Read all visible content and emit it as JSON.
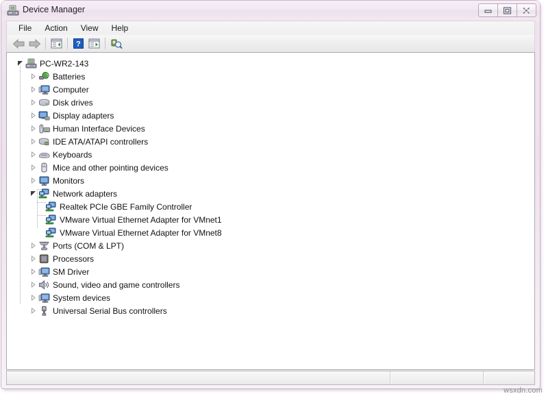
{
  "window": {
    "title": "Device Manager",
    "title_icon": "device-manager-icon",
    "caption_buttons": [
      {
        "name": "minimize-button",
        "glyph": "minimize"
      },
      {
        "name": "maximize-button",
        "glyph": "maximize"
      },
      {
        "name": "close-button",
        "glyph": "close"
      }
    ]
  },
  "menubar": {
    "items": [
      {
        "label": "File",
        "name": "menu-file"
      },
      {
        "label": "Action",
        "name": "menu-action"
      },
      {
        "label": "View",
        "name": "menu-view"
      },
      {
        "label": "Help",
        "name": "menu-help"
      }
    ]
  },
  "toolbar": {
    "buttons": [
      {
        "name": "back-button",
        "icon": "back-arrow-icon",
        "enabled": false
      },
      {
        "name": "forward-button",
        "icon": "forward-arrow-icon",
        "enabled": false
      },
      {
        "name": "show-hide-console-tree-button",
        "icon": "console-tree-icon",
        "enabled": true
      },
      {
        "name": "help-button",
        "icon": "help-question-icon",
        "enabled": true
      },
      {
        "name": "properties-button",
        "icon": "properties-window-icon",
        "enabled": true
      },
      {
        "name": "scan-for-hardware-changes-button",
        "icon": "scan-hardware-icon",
        "enabled": true
      }
    ]
  },
  "tree": {
    "root": {
      "label": "PC-WR2-143",
      "icon": "computer-node-icon",
      "expanded": true
    },
    "items": [
      {
        "label": "Batteries",
        "icon": "battery-icon",
        "expanded": false,
        "level": 1
      },
      {
        "label": "Computer",
        "icon": "computer-icon",
        "expanded": false,
        "level": 1
      },
      {
        "label": "Disk drives",
        "icon": "disk-drive-icon",
        "expanded": false,
        "level": 1
      },
      {
        "label": "Display adapters",
        "icon": "display-adapter-icon",
        "expanded": false,
        "level": 1
      },
      {
        "label": "Human Interface Devices",
        "icon": "hid-icon",
        "expanded": false,
        "level": 1
      },
      {
        "label": "IDE ATA/ATAPI controllers",
        "icon": "ide-controller-icon",
        "expanded": false,
        "level": 1
      },
      {
        "label": "Keyboards",
        "icon": "keyboard-icon",
        "expanded": false,
        "level": 1
      },
      {
        "label": "Mice and other pointing devices",
        "icon": "mouse-icon",
        "expanded": false,
        "level": 1
      },
      {
        "label": "Monitors",
        "icon": "monitor-icon",
        "expanded": false,
        "level": 1
      },
      {
        "label": "Network adapters",
        "icon": "network-adapter-icon",
        "expanded": true,
        "level": 1
      },
      {
        "label": "Realtek PCIe GBE Family Controller",
        "icon": "network-adapter-icon",
        "expanded": null,
        "level": 2
      },
      {
        "label": "VMware Virtual Ethernet Adapter for VMnet1",
        "icon": "network-adapter-icon",
        "expanded": null,
        "level": 2
      },
      {
        "label": "VMware Virtual Ethernet Adapter for VMnet8",
        "icon": "network-adapter-icon",
        "expanded": null,
        "level": 2
      },
      {
        "label": "Ports (COM & LPT)",
        "icon": "port-icon",
        "expanded": false,
        "level": 1
      },
      {
        "label": "Processors",
        "icon": "processor-icon",
        "expanded": false,
        "level": 1
      },
      {
        "label": "SM Driver",
        "icon": "computer-icon",
        "expanded": false,
        "level": 1
      },
      {
        "label": "Sound, video and game controllers",
        "icon": "speaker-icon",
        "expanded": false,
        "level": 1
      },
      {
        "label": "System devices",
        "icon": "computer-icon",
        "expanded": false,
        "level": 1
      },
      {
        "label": "Universal Serial Bus controllers",
        "icon": "usb-icon",
        "expanded": false,
        "level": 1
      }
    ]
  },
  "statusbar": {
    "pane1": "",
    "pane2": "",
    "pane3": ""
  },
  "watermark": {
    "text": "wsxdn.com"
  },
  "colors": {
    "frame": "#efe4ef",
    "frame_border": "#c9b6c9",
    "content_bg": "#ffffff",
    "text": "#111111",
    "help_blue": "#1d5fbf"
  }
}
